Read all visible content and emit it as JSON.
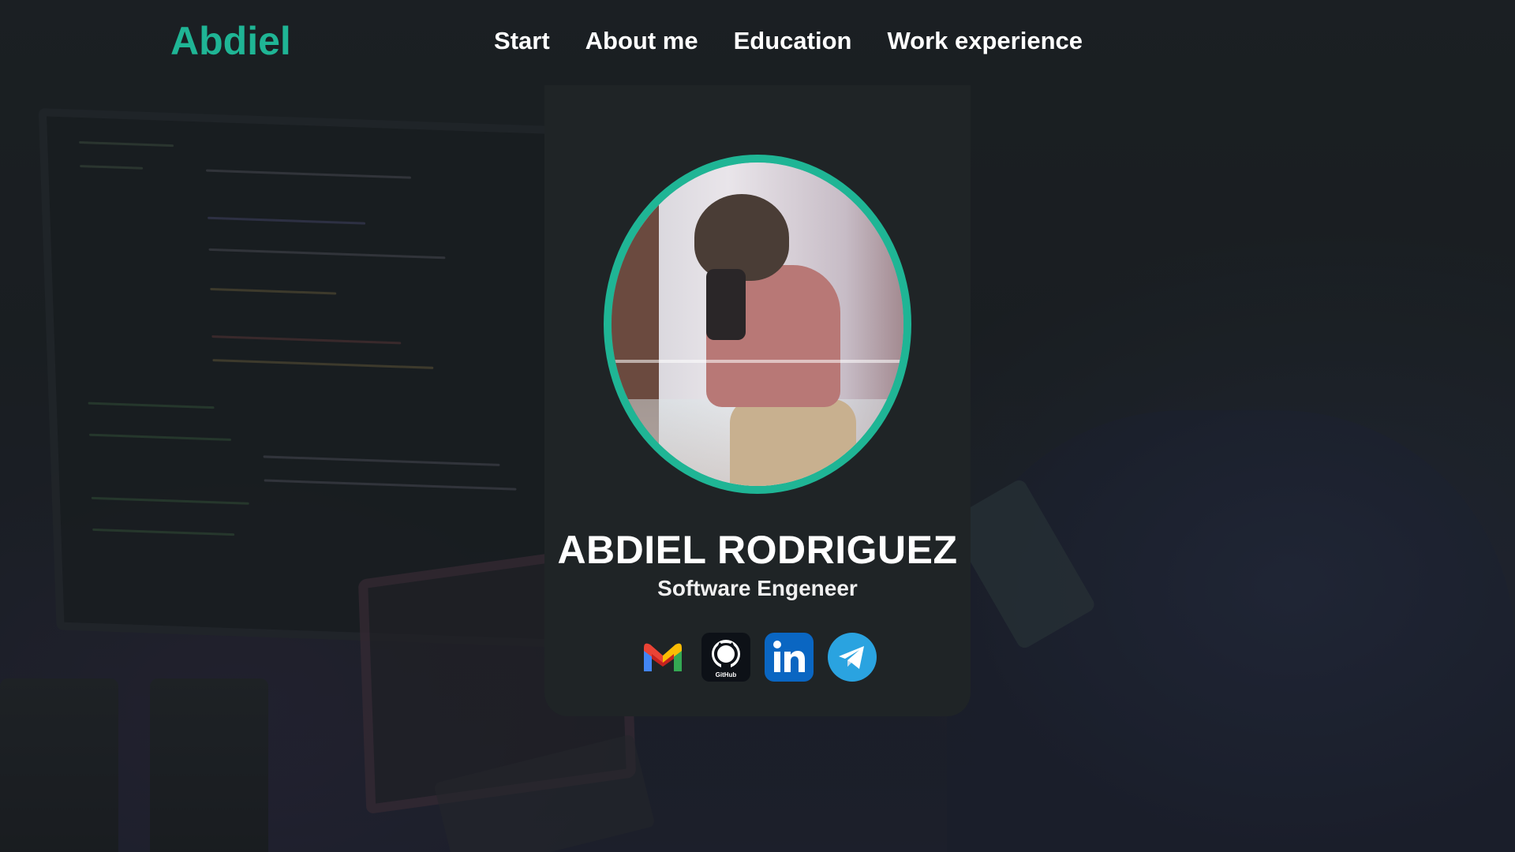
{
  "header": {
    "brand": "Abdiel",
    "nav": [
      "Start",
      "About me",
      "Education",
      "Work experience"
    ]
  },
  "profile": {
    "name": "ABDIEL RODRIGUEZ",
    "role": "Software Engeneer",
    "github_badge": "GitHub"
  },
  "socials": [
    {
      "icon": "gmail-icon"
    },
    {
      "icon": "github-icon"
    },
    {
      "icon": "linkedin-icon"
    },
    {
      "icon": "telegram-icon"
    }
  ],
  "colors": {
    "accent": "#1fb595",
    "card": "#1f2426",
    "background": "#1b2124",
    "linkedin": "#0a66c2",
    "telegram": "#2aa3e0"
  }
}
